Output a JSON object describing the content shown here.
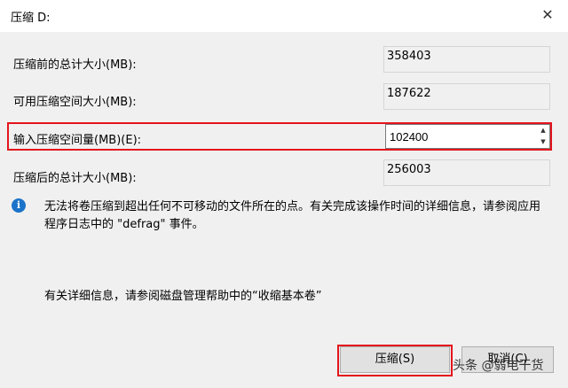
{
  "window": {
    "title": "压缩 D:",
    "close_icon": "close-icon"
  },
  "fields": {
    "total_before_label": "压缩前的总计大小(MB):",
    "total_before_value": "358403",
    "available_label": "可用压缩空间大小(MB):",
    "available_value": "187622",
    "amount_label": "输入压缩空间量(MB)(E):",
    "amount_value": "102400",
    "total_after_label": "压缩后的总计大小(MB):",
    "total_after_value": "256003"
  },
  "info": {
    "icon": "info-icon",
    "text": "无法将卷压缩到超出任何不可移动的文件所在的点。有关完成该操作时间的详细信息，请参阅应用程序日志中的 \"defrag\" 事件。",
    "help_text": "有关详细信息，请参阅磁盘管理帮助中的“收缩基本卷”"
  },
  "buttons": {
    "shrink": "压缩(S)",
    "cancel": "取消(C)"
  },
  "watermark": "头条 @弱电干货",
  "colors": {
    "highlight": "#e4141c",
    "info_icon": "#1a73c9"
  }
}
